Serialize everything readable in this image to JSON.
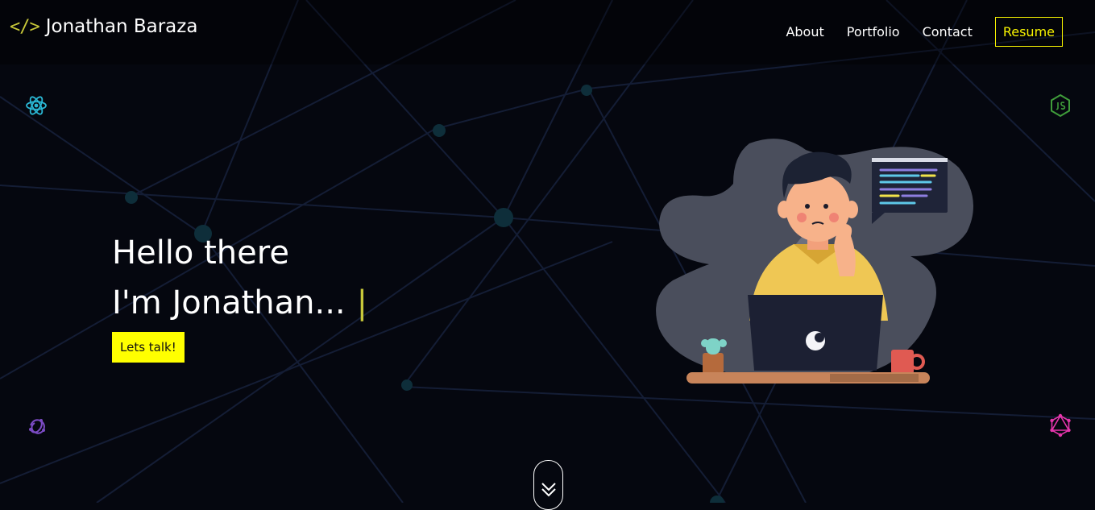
{
  "nav": {
    "brand_code": "</>",
    "brand_name": "Jonathan Baraza",
    "links": [
      "About",
      "Portfolio",
      "Contact"
    ],
    "resume": "Resume"
  },
  "hero": {
    "line1": "Hello there",
    "line2": "I'm Jonathan...",
    "cursor": "|",
    "cta": "Lets talk!"
  },
  "icons": {
    "top_left": "react-icon",
    "top_right": "nodejs-icon",
    "bottom_left": "redux-icon",
    "bottom_right": "graphql-icon",
    "scroll": "double-chevron-down-icon"
  },
  "colors": {
    "accent_yellow": "#ffff00",
    "brand_code": "#c8c83a",
    "background": "#05070f"
  }
}
